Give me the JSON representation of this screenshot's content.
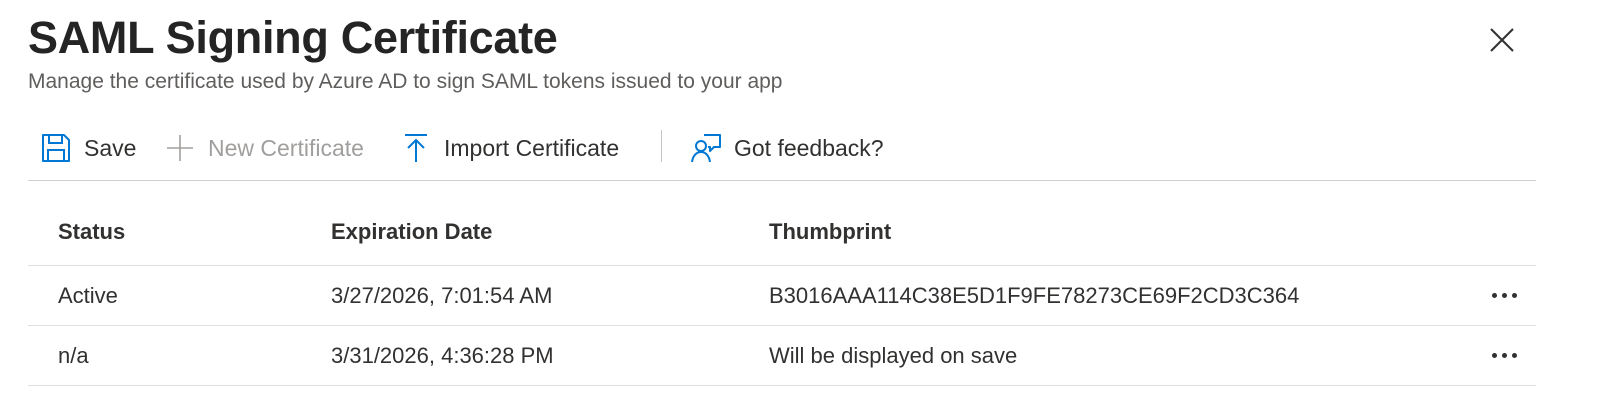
{
  "header": {
    "title": "SAML Signing Certificate",
    "subtitle": "Manage the certificate used by Azure AD to sign SAML tokens issued to your app"
  },
  "toolbar": {
    "save_label": "Save",
    "new_certificate_label": "New Certificate",
    "import_certificate_label": "Import Certificate",
    "feedback_label": "Got feedback?",
    "icons": [
      "save-icon",
      "plus-icon",
      "upload-icon",
      "feedback-icon"
    ]
  },
  "table": {
    "columns": [
      "Status",
      "Expiration Date",
      "Thumbprint"
    ],
    "rows": [
      {
        "status": "Active",
        "expiration": "3/27/2026, 7:01:54 AM",
        "thumbprint": "B3016AAA114C38E5D1F9FE78273CE69F2CD3C364"
      },
      {
        "status": "n/a",
        "expiration": "3/31/2026, 4:36:28 PM",
        "thumbprint": "Will be displayed on save"
      }
    ]
  },
  "colors": {
    "accent": "#0078d4",
    "text": "#323130",
    "disabled": "#a19f9d",
    "divider": "#e1dfdd"
  }
}
